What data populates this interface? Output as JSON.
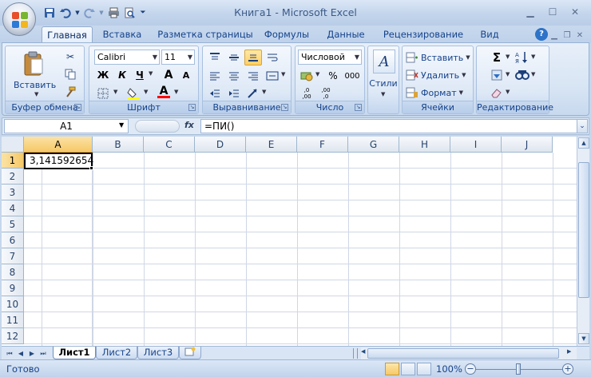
{
  "window": {
    "title": "Книга1 - Microsoft Excel",
    "minimize_icon": "minimize-icon",
    "maximize_icon": "maximize-icon",
    "close_icon": "close-icon"
  },
  "quick_access": [
    "save-icon",
    "undo-icon",
    "redo-icon",
    "print-icon",
    "print-preview-icon",
    "customize-qat-icon"
  ],
  "tabs": [
    {
      "label": "Главная",
      "active": true
    },
    {
      "label": "Вставка"
    },
    {
      "label": "Разметка страницы"
    },
    {
      "label": "Формулы"
    },
    {
      "label": "Данные"
    },
    {
      "label": "Рецензирование"
    },
    {
      "label": "Вид"
    }
  ],
  "ribbon": {
    "clipboard": {
      "label": "Буфер обмена",
      "paste": "Вставить"
    },
    "font": {
      "label": "Шрифт",
      "name": "Calibri",
      "size": "11",
      "bold": "Ж",
      "italic": "К",
      "underline": "Ч",
      "grow": "A",
      "shrink": "A",
      "color_letter": "A",
      "highlight_color": "#ffff00",
      "font_color": "#ff0000"
    },
    "alignment": {
      "label": "Выравнивание"
    },
    "number": {
      "label": "Число",
      "format": "Числовой",
      "percent": "%",
      "thousands": "000",
      "inc_decimal_top": ",0",
      "inc_decimal_bottom": ",00",
      "dec_decimal_top": ",00",
      "dec_decimal_bottom": ",0"
    },
    "styles": {
      "label": "Стили"
    },
    "cells": {
      "label": "Ячейки",
      "insert": "Вставить",
      "delete": "Удалить",
      "format": "Формат"
    },
    "editing": {
      "label": "Редактирование",
      "sum": "Σ"
    }
  },
  "formula_bar": {
    "name_box": "A1",
    "fx": "fx",
    "formula": "=ПИ()"
  },
  "grid": {
    "columns": [
      "A",
      "B",
      "C",
      "D",
      "E",
      "F",
      "G",
      "H",
      "I",
      "J"
    ],
    "rows": [
      "1",
      "2",
      "3",
      "4",
      "5",
      "6",
      "7",
      "8",
      "9",
      "10",
      "11",
      "12"
    ],
    "selected_column": "A",
    "selected_row": "1",
    "cells": {
      "A1": "3,141592654"
    }
  },
  "sheets": [
    {
      "label": "Лист1",
      "active": true
    },
    {
      "label": "Лист2"
    },
    {
      "label": "Лист3"
    }
  ],
  "status": {
    "text": "Готово",
    "zoom": "100%"
  }
}
